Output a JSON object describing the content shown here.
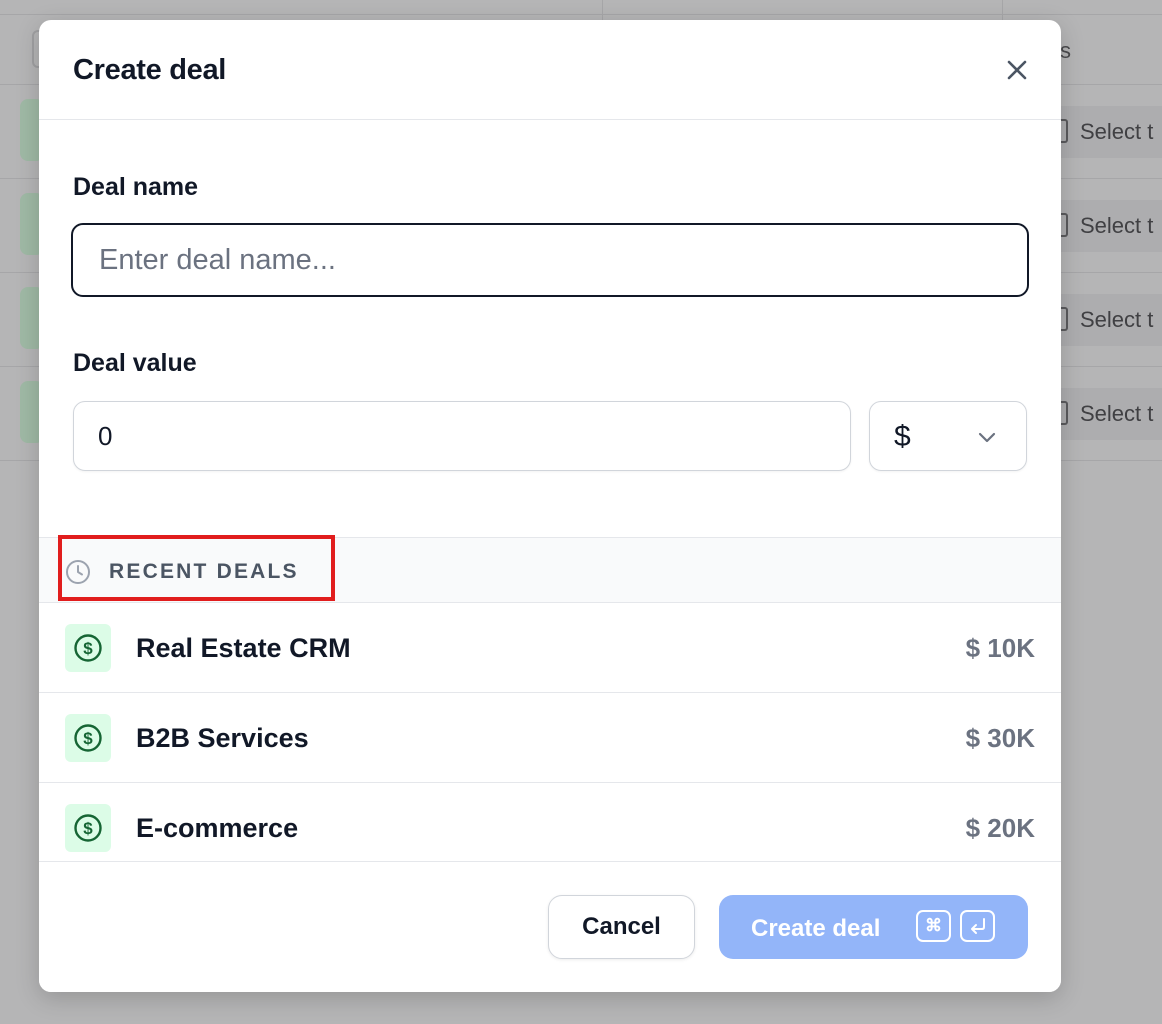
{
  "background": {
    "header_text": "s",
    "row_select_label": "Select t"
  },
  "modal": {
    "title": "Create deal",
    "close_icon": "close-icon",
    "deal_name": {
      "label": "Deal name",
      "value": "",
      "placeholder": "Enter deal name..."
    },
    "deal_value": {
      "label": "Deal value",
      "value": "0",
      "currency": "$"
    },
    "recent_deals": {
      "title": "RECENT DEALS",
      "icon": "clock-icon",
      "items": [
        {
          "name": "Real Estate CRM",
          "value": "$ 10K",
          "icon": "dollar-icon"
        },
        {
          "name": "B2B Services",
          "value": "$ 30K",
          "icon": "dollar-icon"
        },
        {
          "name": "E-commerce",
          "value": "$ 20K",
          "icon": "dollar-icon"
        }
      ]
    },
    "footer": {
      "cancel_label": "Cancel",
      "create_label": "Create deal",
      "shortcut_cmd": "⌘",
      "shortcut_enter_icon": "enter-icon"
    }
  },
  "colors": {
    "primary_disabled": "#93b5f9",
    "highlight": "#e11d1d",
    "deal_icon_bg": "#dcfce7",
    "deal_icon_fg": "#166534"
  }
}
